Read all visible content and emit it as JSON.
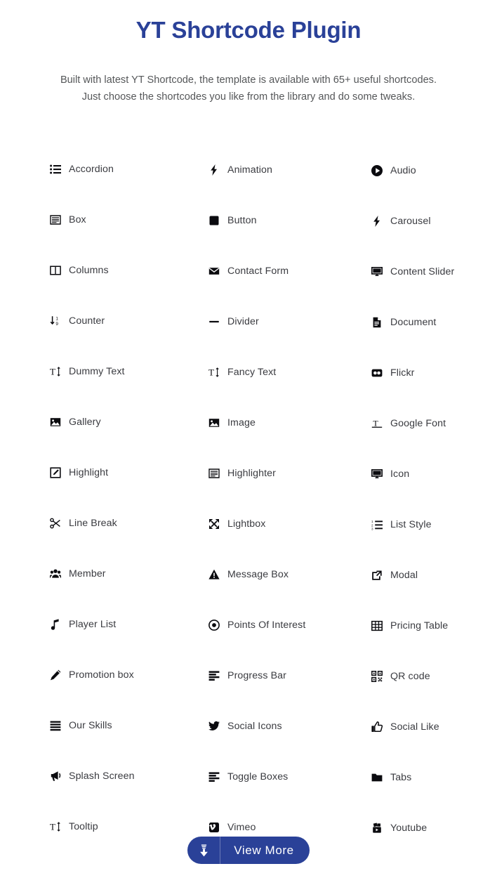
{
  "hero": {
    "title": "YT Shortcode Plugin",
    "subtitle_line1": "Built with latest YT Shortcode, the template is available with 65+ useful shortcodes.",
    "subtitle_line2": "Just choose the shortcodes you like from the library and do some tweaks."
  },
  "colors": {
    "brand": "#2a4198",
    "title": "#2a4198",
    "subtitle": "#555759",
    "label": "#3a3b40",
    "icon": "#0b0b0f",
    "background": "#ffffff",
    "button_bg": "#2a4198",
    "button_text": "#ffffff"
  },
  "shortcodes": [
    {
      "label": "Accordion",
      "icon": "list-ul-icon",
      "column": 1,
      "row": 1
    },
    {
      "label": "Animation",
      "icon": "bolt-icon",
      "column": 2,
      "row": 1
    },
    {
      "label": "Audio",
      "icon": "play-circle-icon",
      "column": 3,
      "row": 1
    },
    {
      "label": "Box",
      "icon": "window-box-icon",
      "column": 1,
      "row": 2
    },
    {
      "label": "Button",
      "icon": "square-filled-icon",
      "column": 2,
      "row": 2
    },
    {
      "label": "Carousel",
      "icon": "bolt-icon",
      "column": 3,
      "row": 2
    },
    {
      "label": "Columns",
      "icon": "columns-icon",
      "column": 1,
      "row": 3
    },
    {
      "label": "Contact Form",
      "icon": "envelope-icon",
      "column": 2,
      "row": 3
    },
    {
      "label": "Content Slider",
      "icon": "desktop-icon",
      "column": 3,
      "row": 3
    },
    {
      "label": "Counter",
      "icon": "sort-numeric-down-icon",
      "column": 1,
      "row": 4
    },
    {
      "label": "Divider",
      "icon": "minus-icon",
      "column": 2,
      "row": 4
    },
    {
      "label": "Document",
      "icon": "file-lines-icon",
      "column": 3,
      "row": 4
    },
    {
      "label": "Dummy Text",
      "icon": "text-height-icon",
      "column": 1,
      "row": 5
    },
    {
      "label": "Fancy Text",
      "icon": "text-height-icon",
      "column": 2,
      "row": 5
    },
    {
      "label": "Flickr",
      "icon": "flickr-icon",
      "column": 3,
      "row": 5
    },
    {
      "label": "Gallery",
      "icon": "image-icon",
      "column": 1,
      "row": 6
    },
    {
      "label": "Image",
      "icon": "image-icon",
      "column": 2,
      "row": 6
    },
    {
      "label": "Google Font",
      "icon": "text-width-icon",
      "column": 3,
      "row": 6
    },
    {
      "label": "Highlight",
      "icon": "pen-square-icon",
      "column": 1,
      "row": 7
    },
    {
      "label": "Highlighter",
      "icon": "window-box-icon",
      "column": 2,
      "row": 7
    },
    {
      "label": "Icon",
      "icon": "desktop-icon",
      "column": 3,
      "row": 7
    },
    {
      "label": "Line Break",
      "icon": "scissors-icon",
      "column": 1,
      "row": 8
    },
    {
      "label": "Lightbox",
      "icon": "expand-arrows-icon",
      "column": 2,
      "row": 8
    },
    {
      "label": "List Style",
      "icon": "list-ol-icon",
      "column": 3,
      "row": 8
    },
    {
      "label": "Member",
      "icon": "users-icon",
      "column": 1,
      "row": 9
    },
    {
      "label": "Message Box",
      "icon": "exclamation-triangle-icon",
      "column": 2,
      "row": 9
    },
    {
      "label": "Modal",
      "icon": "external-link-icon",
      "column": 3,
      "row": 9
    },
    {
      "label": "Player List",
      "icon": "music-note-icon",
      "column": 1,
      "row": 10
    },
    {
      "label": "Points Of Interest",
      "icon": "dot-circle-icon",
      "column": 2,
      "row": 10
    },
    {
      "label": "Pricing Table",
      "icon": "table-icon",
      "column": 3,
      "row": 10
    },
    {
      "label": "Promotion box",
      "icon": "pencil-icon",
      "column": 1,
      "row": 11
    },
    {
      "label": "Progress Bar",
      "icon": "align-left-bars-icon",
      "column": 2,
      "row": 11
    },
    {
      "label": "QR code",
      "icon": "qrcode-icon",
      "column": 3,
      "row": 11
    },
    {
      "label": "Our Skills",
      "icon": "align-justify-icon",
      "column": 1,
      "row": 12
    },
    {
      "label": "Social Icons",
      "icon": "twitter-icon",
      "column": 2,
      "row": 12
    },
    {
      "label": "Social Like",
      "icon": "thumbs-up-icon",
      "column": 3,
      "row": 12
    },
    {
      "label": "Splash Screen",
      "icon": "bullhorn-icon",
      "column": 1,
      "row": 13
    },
    {
      "label": "Toggle Boxes",
      "icon": "align-left-bars-icon",
      "column": 2,
      "row": 13
    },
    {
      "label": "Tabs",
      "icon": "folder-icon",
      "column": 3,
      "row": 13
    },
    {
      "label": "Tooltip",
      "icon": "text-height-icon",
      "column": 1,
      "row": 14
    },
    {
      "label": "Vimeo",
      "icon": "vimeo-icon",
      "column": 2,
      "row": 14
    },
    {
      "label": "Youtube",
      "icon": "youtube-icon",
      "column": 3,
      "row": 14
    }
  ],
  "view_more_button": {
    "label": "View More",
    "icon": "download-arrow-icon"
  }
}
